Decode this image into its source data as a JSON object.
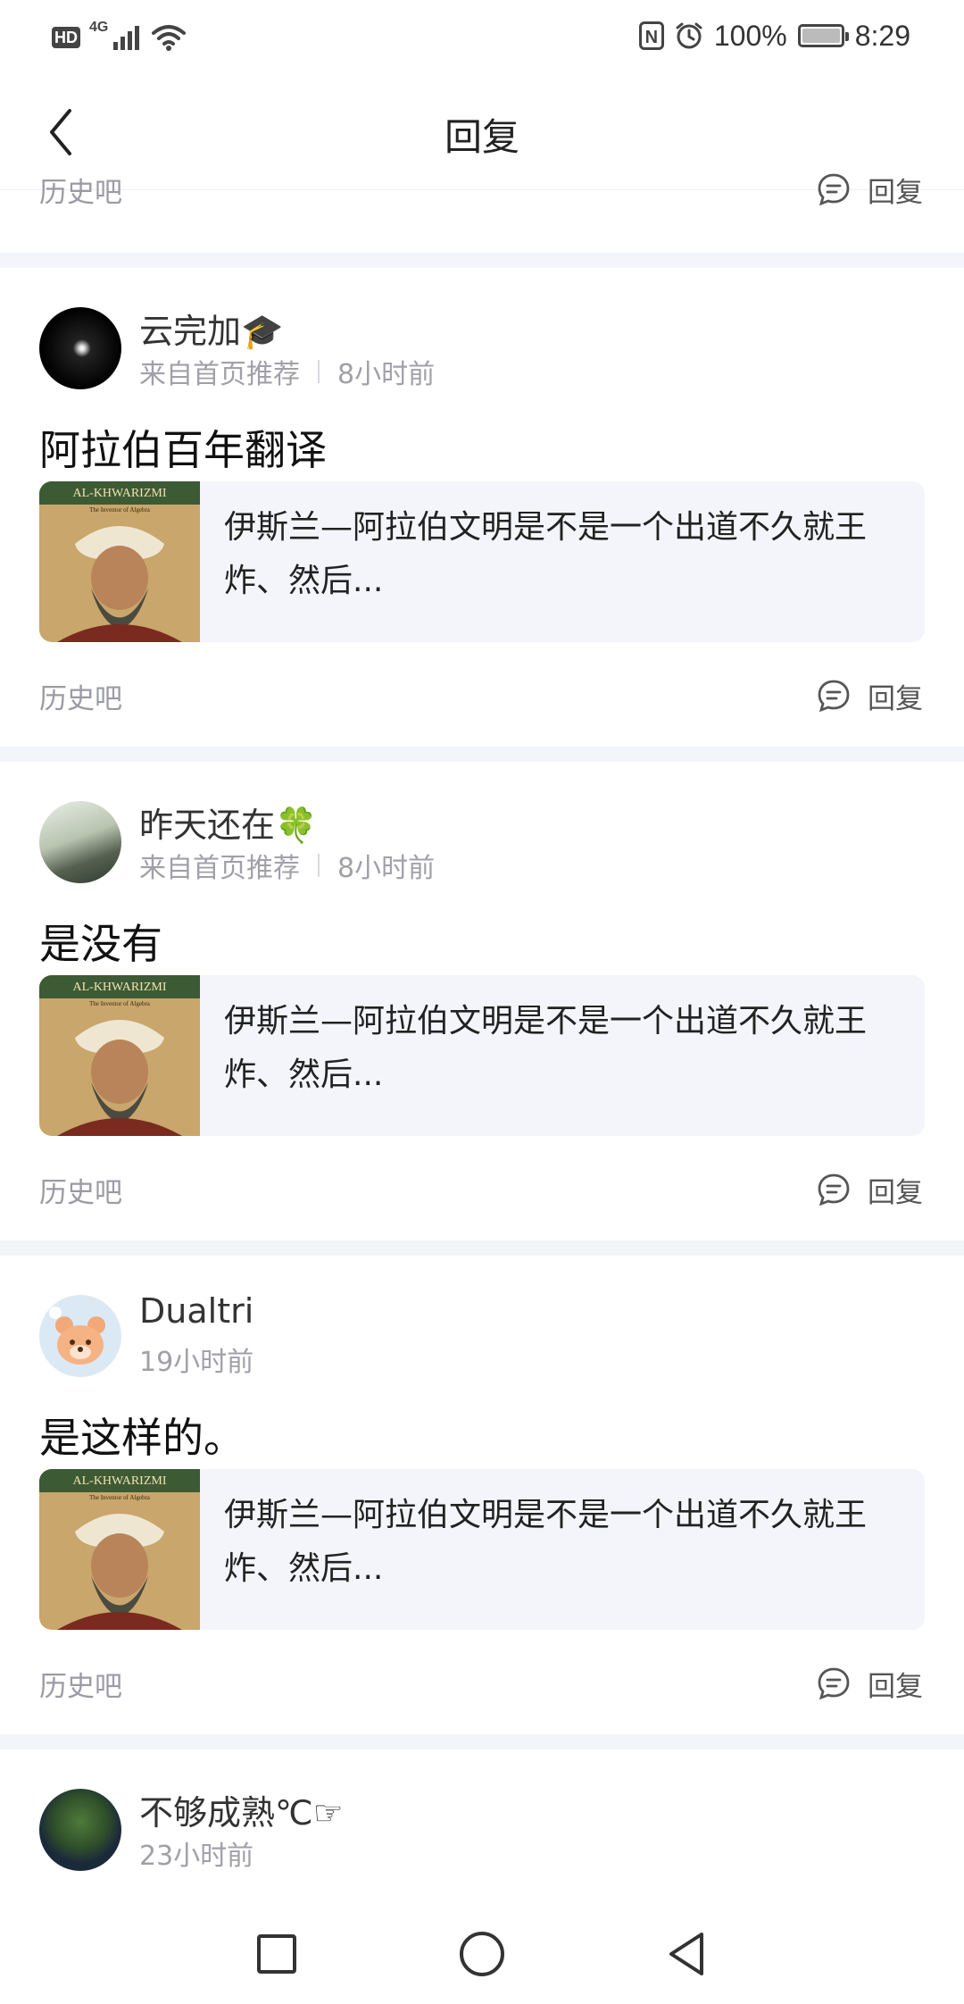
{
  "status_bar": {
    "hd": "HD",
    "network": "4G",
    "battery_text": "100%",
    "battery_level": 1.0,
    "time": "8:29",
    "nfc_icon": "nfc-icon",
    "alarm_icon": "alarm-icon"
  },
  "header": {
    "title": "回复",
    "back_icon": "chevron-left-icon"
  },
  "partial_top": {
    "forum": "历史吧",
    "reply_label": "回复"
  },
  "posts": [
    {
      "username": "云完加🎓",
      "source": "来自首页推荐",
      "time": "8小时前",
      "text": "阿拉伯百年翻译",
      "quote": "伊斯兰—阿拉伯文明是不是一个出道不久就王炸、然后...",
      "thumb_caption": "AL-KHWARIZMI",
      "thumb_subcaption": "The Inventor of Algebra",
      "forum": "历史吧",
      "reply_label": "回复"
    },
    {
      "username": "昨天还在🍀",
      "source": "来自首页推荐",
      "time": "8小时前",
      "text": "是没有",
      "quote": "伊斯兰—阿拉伯文明是不是一个出道不久就王炸、然后...",
      "thumb_caption": "AL-KHWARIZMI",
      "thumb_subcaption": "The Inventor of Algebra",
      "forum": "历史吧",
      "reply_label": "回复"
    },
    {
      "username": "Dualtri",
      "time": "19小时前",
      "text": "是这样的。",
      "quote": "伊斯兰—阿拉伯文明是不是一个出道不久就王炸、然后...",
      "thumb_caption": "AL-KHWARIZMI",
      "thumb_subcaption": "The Inventor of Algebra",
      "forum": "历史吧",
      "reply_label": "回复"
    },
    {
      "username": "不够成熟℃☞",
      "time": "23小时前"
    }
  ],
  "nav_bar": {
    "recent_icon": "square-icon",
    "home_icon": "circle-icon",
    "back_icon": "triangle-back-icon"
  },
  "colors": {
    "background": "#f4f5fb",
    "card": "#ffffff",
    "muted_text": "#9b9ba5",
    "quote_bg": "#f4f5fb"
  }
}
